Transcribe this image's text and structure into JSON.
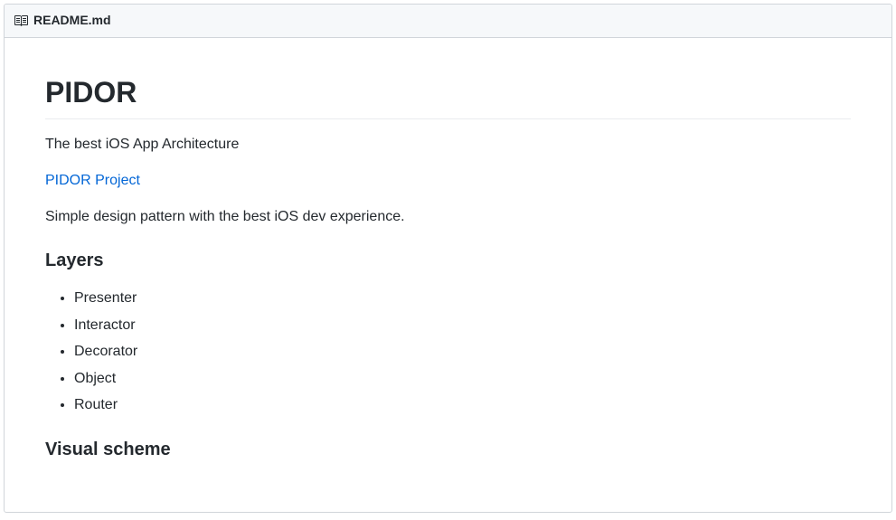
{
  "header": {
    "filename": "README.md"
  },
  "content": {
    "title": "PIDOR",
    "subtitle": "The best iOS App Architecture",
    "link_text": "PIDOR Project",
    "description": "Simple design pattern with the best iOS dev experience.",
    "section_layers": {
      "heading": "Layers",
      "items": [
        "Presenter",
        "Interactor",
        "Decorator",
        "Object",
        "Router"
      ]
    },
    "section_visual": {
      "heading": "Visual scheme"
    }
  }
}
